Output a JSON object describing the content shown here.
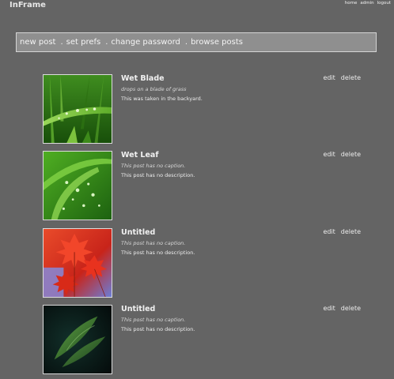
{
  "header": {
    "site_title": "InFrame",
    "top_links": {
      "home": "home",
      "admin": "admin",
      "logout": "logout"
    }
  },
  "nav": {
    "items": [
      "new post",
      "set prefs",
      "change password",
      "browse posts"
    ],
    "separator": "."
  },
  "posts": [
    {
      "title": "Wet Blade",
      "caption": "drops on a blade of grass",
      "description": "This was taken in the backyard.",
      "edit_label": "edit",
      "delete_label": "delete",
      "thumb_icon": "grass-blade-image"
    },
    {
      "title": "Wet Leaf",
      "caption": "This post has no caption.",
      "description": "This post has no description.",
      "edit_label": "edit",
      "delete_label": "delete",
      "thumb_icon": "wet-leaf-image"
    },
    {
      "title": "Untitled",
      "caption": "This post has no caption.",
      "description": "This post has no description.",
      "edit_label": "edit",
      "delete_label": "delete",
      "thumb_icon": "red-maple-leaves-image"
    },
    {
      "title": "Untitled",
      "caption": "This post has no caption.",
      "description": "This post has no description.",
      "edit_label": "edit",
      "delete_label": "delete",
      "thumb_icon": "dark-leaves-image"
    }
  ],
  "colors": {
    "background": "#646464",
    "nav_bar": "#8f8f8f",
    "text": "#e8e8e8"
  }
}
